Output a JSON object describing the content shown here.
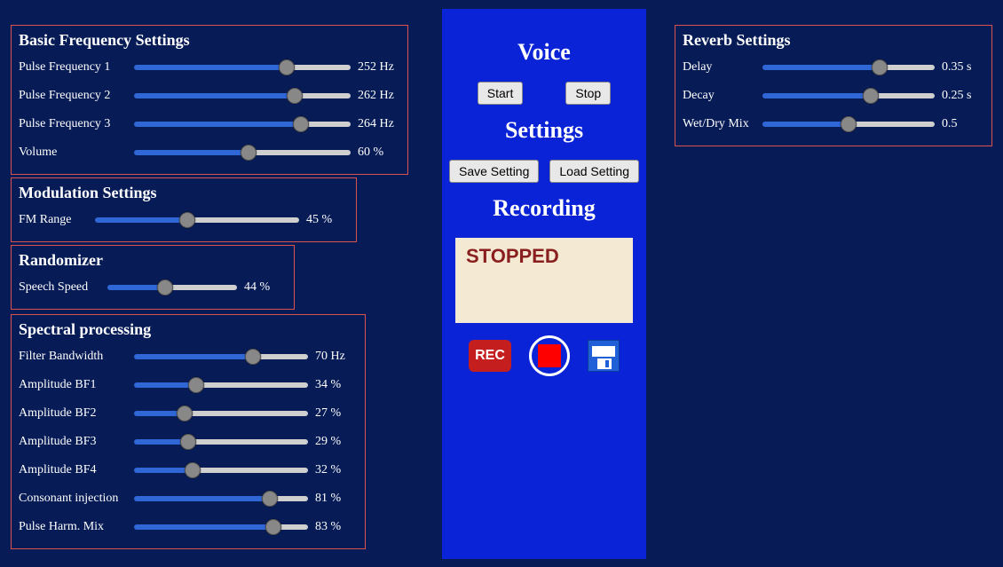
{
  "colors": {
    "accent_blue": "#2f67d6",
    "track_gray": "#cfcfcf"
  },
  "panels": {
    "basic": {
      "title": "Basic Frequency Settings",
      "rows": [
        {
          "label": "Pulse Frequency 1",
          "pct": 72,
          "value": "252 Hz"
        },
        {
          "label": "Pulse Frequency 2",
          "pct": 76,
          "value": "262 Hz"
        },
        {
          "label": "Pulse Frequency 3",
          "pct": 79,
          "value": "264 Hz"
        },
        {
          "label": "Volume",
          "pct": 53,
          "value": "60 %"
        }
      ]
    },
    "mod": {
      "title": "Modulation Settings",
      "rows": [
        {
          "label": "FM Range",
          "pct": 45,
          "value": "45 %"
        }
      ]
    },
    "rand": {
      "title": "Randomizer",
      "rows": [
        {
          "label": "Speech Speed",
          "pct": 44,
          "value": "44 %"
        }
      ]
    },
    "spec": {
      "title": "Spectral processing",
      "rows": [
        {
          "label": "Filter Bandwidth",
          "pct": 70,
          "value": "70 Hz"
        },
        {
          "label": "Amplitude BF1",
          "pct": 34,
          "value": "34 %"
        },
        {
          "label": "Amplitude BF2",
          "pct": 27,
          "value": "27 %"
        },
        {
          "label": "Amplitude BF3",
          "pct": 29,
          "value": "29 %"
        },
        {
          "label": "Amplitude BF4",
          "pct": 32,
          "value": "32 %"
        },
        {
          "label": "Consonant injection",
          "pct": 81,
          "value": "81 %"
        },
        {
          "label": "Pulse Harm. Mix",
          "pct": 83,
          "value": "83 %"
        }
      ]
    },
    "reverb": {
      "title": "Reverb Settings",
      "rows": [
        {
          "label": "Delay",
          "pct": 70,
          "value": "0.35 s"
        },
        {
          "label": "Decay",
          "pct": 64,
          "value": "0.25 s"
        },
        {
          "label": "Wet/Dry Mix",
          "pct": 50,
          "value": "0.5"
        }
      ]
    }
  },
  "center": {
    "voice_heading": "Voice",
    "start_label": "Start",
    "stop_label": "Stop",
    "settings_heading": "Settings",
    "save_setting_label": "Save Setting",
    "load_setting_label": "Load Setting",
    "recording_heading": "Recording",
    "recording_status": "STOPPED",
    "rec_label": "REC"
  }
}
